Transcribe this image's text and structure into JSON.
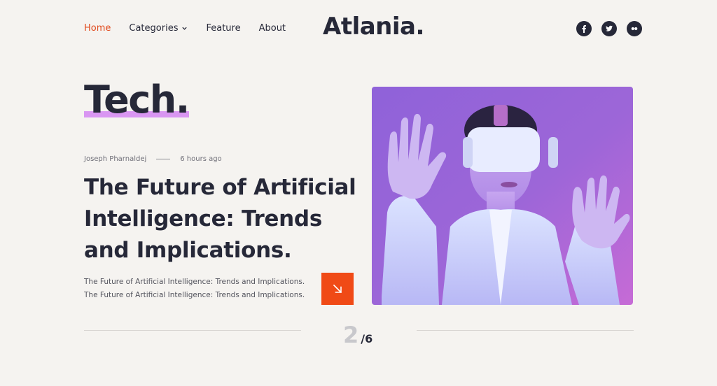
{
  "header": {
    "nav": [
      {
        "label": "Home"
      },
      {
        "label": "Categories"
      },
      {
        "label": "Feature"
      },
      {
        "label": "About"
      }
    ],
    "logo": "Atlania.",
    "socials": [
      "facebook-icon",
      "twitter-icon",
      "flickr-icon"
    ]
  },
  "post": {
    "category": "Tech.",
    "author": "Joseph Pharnaldej",
    "time": "6 hours ago",
    "title": "The Future of Artificial Intelligence: Trends and Implications.",
    "excerpt": "The Future of Artificial Intelligence: Trends and Implications. The Future of Artificial Intelligence: Trends and Implications.",
    "read_icon": "arrow-down-right-icon"
  },
  "pager": {
    "current": "2",
    "total": "/6"
  },
  "colors": {
    "accent": "#f04a16",
    "active_nav": "#e14b1e",
    "highlight": "#d996f2",
    "dark": "#262838",
    "background": "#f5f3f0"
  }
}
